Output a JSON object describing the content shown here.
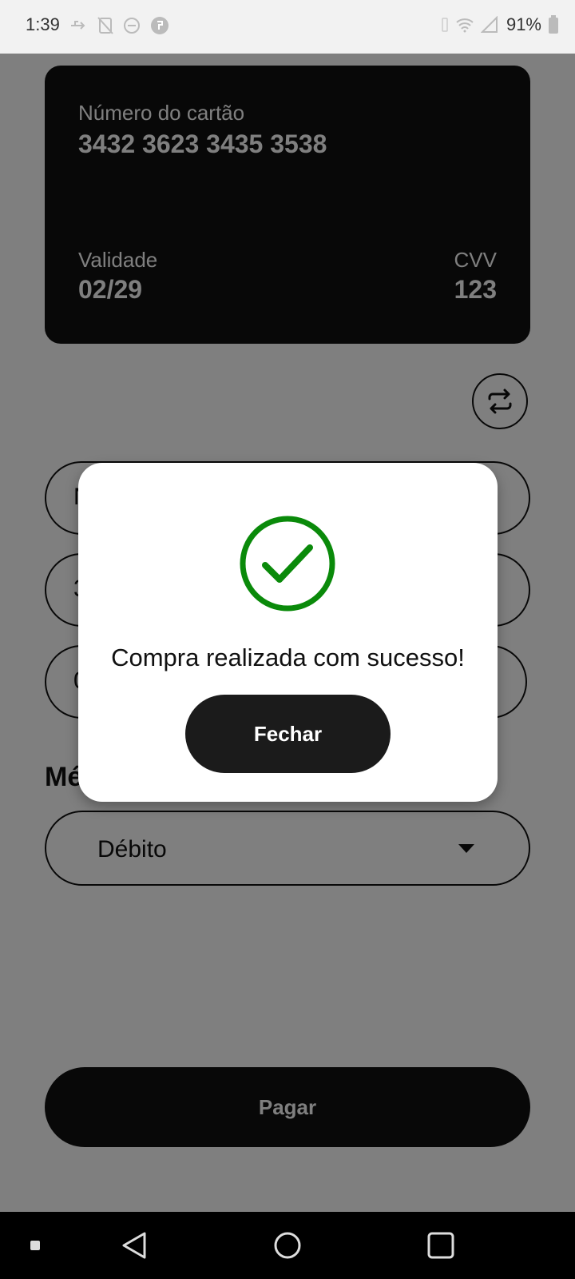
{
  "status_bar": {
    "time": "1:39",
    "battery": "91%"
  },
  "card": {
    "number_label": "Número do cartão",
    "number": "3432 3623 3435 3538",
    "validity_label": "Validade",
    "validity": "02/29",
    "cvv_label": "CVV",
    "cvv": "123"
  },
  "form": {
    "name_partial": "N",
    "number_partial": "3",
    "date_partial": "0",
    "section_title_partial": "Mé",
    "payment_method": "Débito"
  },
  "pay_button_label": "Pagar",
  "dialog": {
    "message": "Compra realizada com sucesso!",
    "close_label": "Fechar",
    "success_color": "#0a8a0a"
  },
  "icons": {
    "flip": "swap-arrows-icon",
    "success": "check-circle-icon",
    "dropdown": "caret-down-icon",
    "nav_back": "back-triangle-icon",
    "nav_home": "home-circle-icon",
    "nav_recents": "recents-square-icon"
  }
}
